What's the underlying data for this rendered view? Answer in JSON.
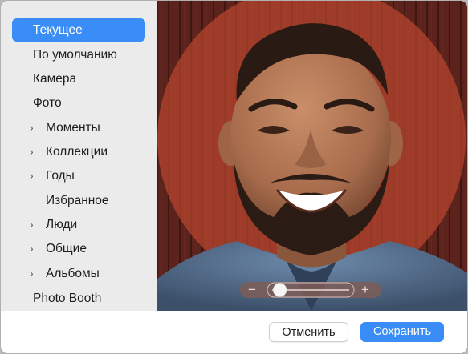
{
  "sidebar": {
    "items": [
      {
        "label": "Текущее",
        "selected": true,
        "chevron": false
      },
      {
        "label": "По умолчанию",
        "chevron": false
      },
      {
        "label": "Камера",
        "chevron": false
      },
      {
        "label": "Фото",
        "chevron": false
      },
      {
        "label": "Моменты",
        "chevron": true
      },
      {
        "label": "Коллекции",
        "chevron": true
      },
      {
        "label": "Годы",
        "chevron": true
      },
      {
        "label": "Избранное",
        "chevron": false
      },
      {
        "label": "Люди",
        "chevron": true
      },
      {
        "label": "Общие",
        "chevron": true
      },
      {
        "label": "Альбомы",
        "chevron": true
      },
      {
        "label": "Photo Booth",
        "chevron": false
      }
    ]
  },
  "zoom": {
    "minus_glyph": "−",
    "plus_glyph": "+",
    "level": 0.1
  },
  "footer": {
    "cancel_label": "Отменить",
    "save_label": "Сохранить"
  },
  "colors": {
    "accent": "#3a8cf7",
    "sidebar_bg": "#ebebeb",
    "crop_circle": "#c0492f"
  }
}
